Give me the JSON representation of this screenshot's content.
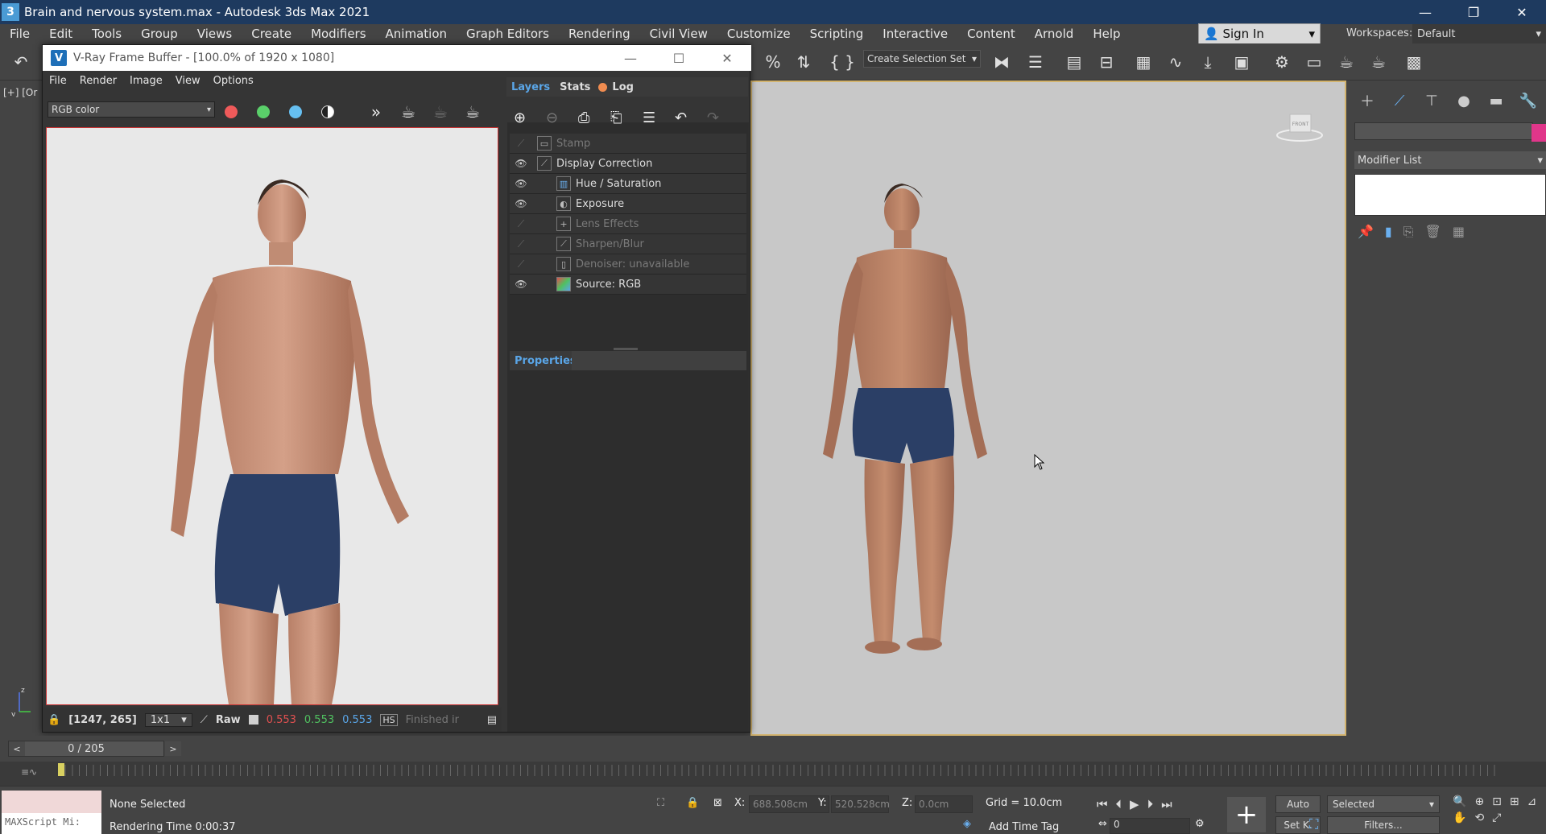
{
  "window": {
    "app_badge": "3",
    "title": "Brain and nervous system.max - Autodesk 3ds Max 2021",
    "controls": [
      "—",
      "❐",
      "✕"
    ]
  },
  "menu": [
    "File",
    "Edit",
    "Tools",
    "Group",
    "Views",
    "Create",
    "Modifiers",
    "Animation",
    "Graph Editors",
    "Rendering",
    "Civil View",
    "Customize",
    "Scripting",
    "Interactive",
    "Content",
    "Arnold",
    "Help"
  ],
  "account": {
    "sign_in": "Sign In",
    "workspaces_label": "Workspaces:",
    "workspace": "Default"
  },
  "toolbar": {
    "selection_set_placeholder": "Create Selection Set"
  },
  "viewport": {
    "label": "[+] [Or",
    "viewcube_label": "FRONT"
  },
  "command_panel": {
    "modifier_list": "Modifier List",
    "accent_color": "#e0368a"
  },
  "vfb": {
    "title": "V-Ray Frame Buffer - [100.0% of 1920 x 1080]",
    "menu": [
      "File",
      "Render",
      "Image",
      "View",
      "Options"
    ],
    "channel": "RGB color",
    "panel_tabs": [
      "Layers",
      "Stats",
      "Log"
    ],
    "layers": [
      {
        "name": "Stamp",
        "visible": false,
        "indent": 0
      },
      {
        "name": "Display Correction",
        "visible": true,
        "indent": 0
      },
      {
        "name": "Hue / Saturation",
        "visible": true,
        "indent": 1
      },
      {
        "name": "Exposure",
        "visible": true,
        "indent": 1
      },
      {
        "name": "Lens Effects",
        "visible": false,
        "indent": 1
      },
      {
        "name": "Sharpen/Blur",
        "visible": false,
        "indent": 1
      },
      {
        "name": "Denoiser: unavailable",
        "visible": false,
        "indent": 1
      },
      {
        "name": "Source: RGB",
        "visible": true,
        "indent": 1
      }
    ],
    "properties_label": "Properties",
    "status": {
      "coords": "[1247, 265]",
      "zoom": "1x1",
      "raw_label": "Raw",
      "r": "0.553",
      "g": "0.553",
      "b": "0.553",
      "hs": "HS",
      "finished": "Finished ir"
    }
  },
  "timeline": {
    "frame": "0 / 205",
    "left_arrow": "<",
    "right_arrow": ">"
  },
  "status": {
    "maxscript": "MAXScript Mi:",
    "selection": "None Selected",
    "render_time": "Rendering Time  0:00:37",
    "x_label": "X:",
    "x_val": "688.508cm",
    "y_label": "Y:",
    "y_val": "520.528cm",
    "z_label": "Z:",
    "z_val": "0.0cm",
    "grid": "Grid = 10.0cm",
    "add_time_tag": "Add Time Tag",
    "auto": "Auto",
    "selected": "Selected",
    "set_key": "Set K.",
    "filters": "Filters...",
    "frame_field": "0"
  }
}
